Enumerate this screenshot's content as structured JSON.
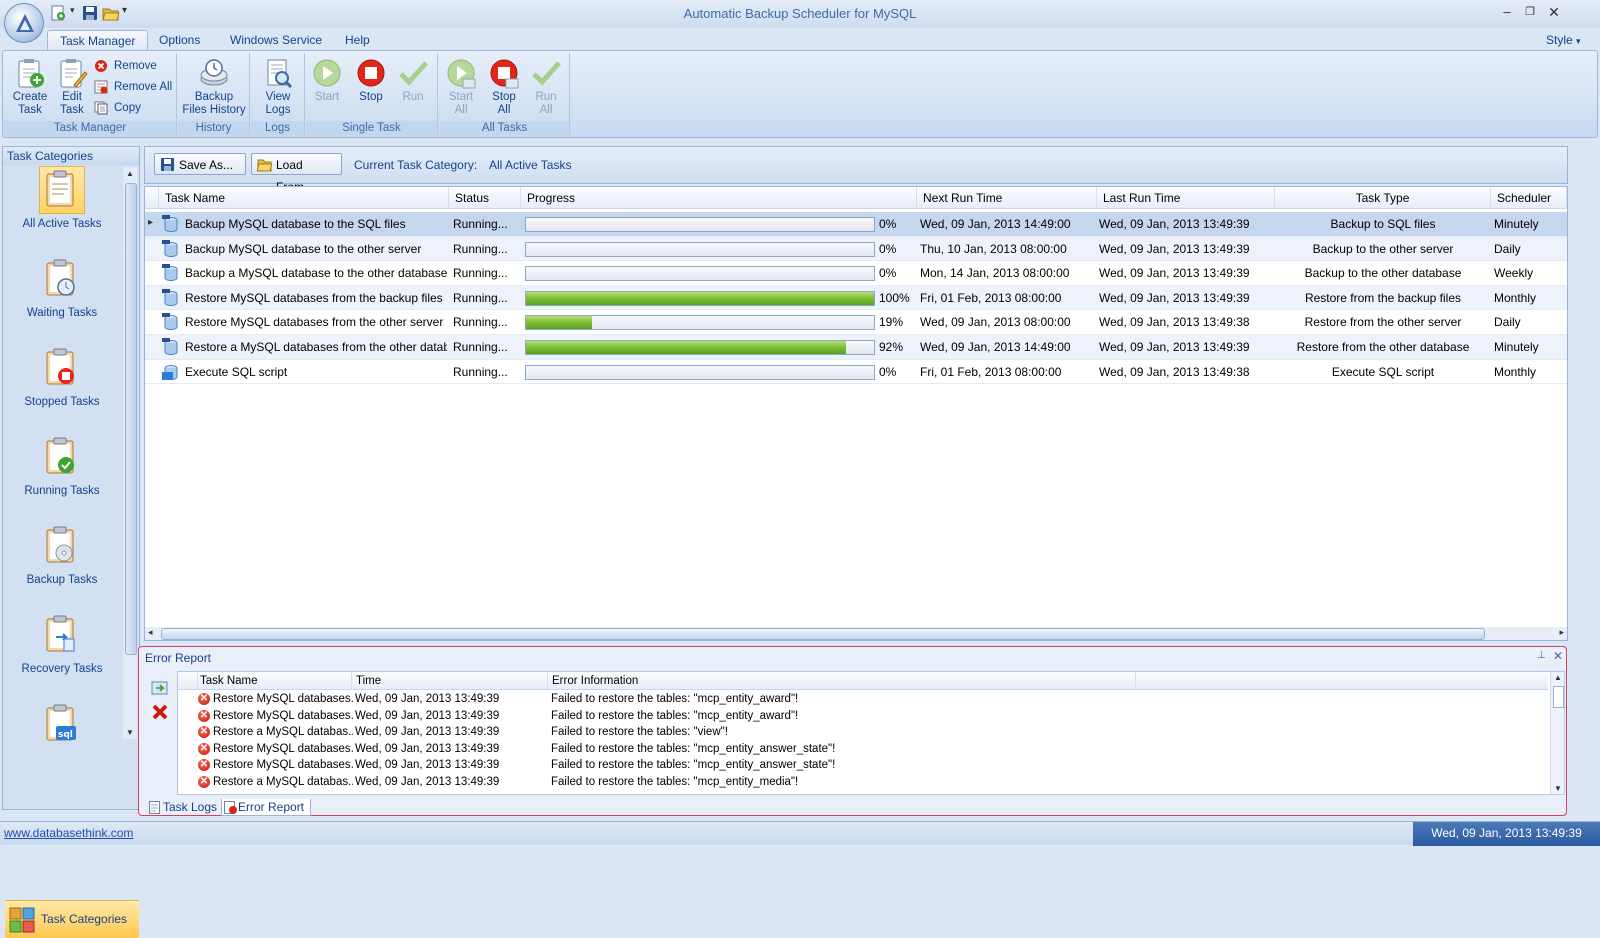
{
  "window": {
    "title": "Automatic Backup Scheduler for MySQL",
    "style_label": "Style"
  },
  "ribbon_tabs": [
    {
      "label": "Task Manager",
      "active": true
    },
    {
      "label": "Options",
      "active": false
    },
    {
      "label": "Windows Service",
      "active": false
    },
    {
      "label": "Help",
      "active": false
    }
  ],
  "ribbon": {
    "task_manager": {
      "group_label": "Task Manager",
      "create_task": "Create\nTask",
      "edit_task": "Edit\nTask",
      "remove": "Remove",
      "remove_all": "Remove All",
      "copy": "Copy"
    },
    "history": {
      "group_label": "History",
      "backup_files_history": "Backup\nFiles History"
    },
    "logs": {
      "group_label": "Logs",
      "view_logs": "View\nLogs"
    },
    "single_task": {
      "group_label": "Single Task",
      "start": "Start",
      "stop": "Stop",
      "run": "Run"
    },
    "all_tasks": {
      "group_label": "All Tasks",
      "start_all": "Start\nAll",
      "stop_all": "Stop\nAll",
      "run_all": "Run\nAll"
    }
  },
  "left_panel": {
    "header": "Task Categories",
    "categories": [
      {
        "label": "All Active Tasks",
        "icon": "clipboard-list-icon"
      },
      {
        "label": "Waiting Tasks",
        "icon": "clipboard-clock-icon"
      },
      {
        "label": "Stopped Tasks",
        "icon": "clipboard-stop-icon"
      },
      {
        "label": "Running Tasks",
        "icon": "clipboard-check-icon"
      },
      {
        "label": "Backup Tasks",
        "icon": "clipboard-disc-icon"
      },
      {
        "label": "Recovery Tasks",
        "icon": "clipboard-restore-icon"
      },
      {
        "label": "",
        "icon": "clipboard-sql-icon"
      }
    ],
    "footer_button": "Task Categories"
  },
  "toolbar": {
    "save_as": "Save As...",
    "load_from": "Load From...",
    "current_category_label": "Current Task Category:",
    "current_category_value": "All Active Tasks"
  },
  "task_grid": {
    "columns": [
      "Task Name",
      "Status",
      "Progress",
      "Next Run Time",
      "Last Run Time",
      "Task Type",
      "Scheduler"
    ],
    "rows": [
      {
        "name": "Backup MySQL database to the SQL files",
        "status": "Running...",
        "progress": 0,
        "progress_label": "0%",
        "next_run": "Wed, 09 Jan, 2013 14:49:00",
        "last_run": "Wed, 09 Jan, 2013 13:49:39",
        "type": "Backup to SQL files",
        "scheduler": "Minutely"
      },
      {
        "name": "Backup MySQL database to the other server",
        "status": "Running...",
        "progress": 0,
        "progress_label": "0%",
        "next_run": "Thu, 10 Jan, 2013 08:00:00",
        "last_run": "Wed, 09 Jan, 2013 13:49:39",
        "type": "Backup to the other server",
        "scheduler": "Daily"
      },
      {
        "name": "Backup a MySQL database to the other database",
        "status": "Running...",
        "progress": 0,
        "progress_label": "0%",
        "next_run": "Mon, 14 Jan, 2013 08:00:00",
        "last_run": "Wed, 09 Jan, 2013 13:49:39",
        "type": "Backup to the other database",
        "scheduler": "Weekly"
      },
      {
        "name": "Restore MySQL databases from the backup files",
        "status": "Running...",
        "progress": 100,
        "progress_label": "100%",
        "next_run": "Fri, 01 Feb, 2013 08:00:00",
        "last_run": "Wed, 09 Jan, 2013 13:49:39",
        "type": "Restore from the backup files",
        "scheduler": "Monthly"
      },
      {
        "name": "Restore MySQL databases from the other server",
        "status": "Running...",
        "progress": 19,
        "progress_label": "19%",
        "next_run": "Wed, 09 Jan, 2013 08:00:00",
        "last_run": "Wed, 09 Jan, 2013 13:49:38",
        "type": "Restore from the other server",
        "scheduler": "Daily"
      },
      {
        "name": "Restore a MySQL databases from the other databases",
        "status": "Running...",
        "progress": 92,
        "progress_label": "92%",
        "next_run": "Wed, 09 Jan, 2013 14:49:00",
        "last_run": "Wed, 09 Jan, 2013 13:49:39",
        "type": "Restore from the other database",
        "scheduler": "Minutely"
      },
      {
        "name": "Execute SQL script",
        "status": "Running...",
        "progress": 0,
        "progress_label": "0%",
        "next_run": "Fri, 01 Feb, 2013 08:00:00",
        "last_run": "Wed, 09 Jan, 2013 13:49:38",
        "type": "Execute SQL script",
        "scheduler": "Monthly"
      }
    ]
  },
  "error_report": {
    "title": "Error Report",
    "columns": [
      "Task Name",
      "Time",
      "Error Information"
    ],
    "rows": [
      {
        "task": "Restore MySQL databases...",
        "time": "Wed, 09 Jan, 2013 13:49:39",
        "info": "Failed to restore the tables: \"mcp_entity_award\"!"
      },
      {
        "task": "Restore MySQL databases...",
        "time": "Wed, 09 Jan, 2013 13:49:39",
        "info": "Failed to restore the tables: \"mcp_entity_award\"!"
      },
      {
        "task": "Restore a MySQL databas...",
        "time": "Wed, 09 Jan, 2013 13:49:39",
        "info": "Failed to restore the tables: \"view\"!"
      },
      {
        "task": "Restore MySQL databases...",
        "time": "Wed, 09 Jan, 2013 13:49:39",
        "info": "Failed to restore the tables: \"mcp_entity_answer_state\"!"
      },
      {
        "task": "Restore MySQL databases...",
        "time": "Wed, 09 Jan, 2013 13:49:39",
        "info": "Failed to restore the tables: \"mcp_entity_answer_state\"!"
      },
      {
        "task": "Restore a MySQL databas...",
        "time": "Wed, 09 Jan, 2013 13:49:39",
        "info": "Failed to restore the tables: \"mcp_entity_media\"!"
      }
    ],
    "bottom_tabs": [
      "Task Logs",
      "Error Report"
    ]
  },
  "status_bar": {
    "link": "www.databasethink.com",
    "datetime": "Wed, 09 Jan, 2013 13:49:39"
  },
  "colors": {
    "accent": "#15428b",
    "progress_green": "#6cb32a",
    "selected_row": "#c5d6ee",
    "error_border": "#d0435a"
  }
}
